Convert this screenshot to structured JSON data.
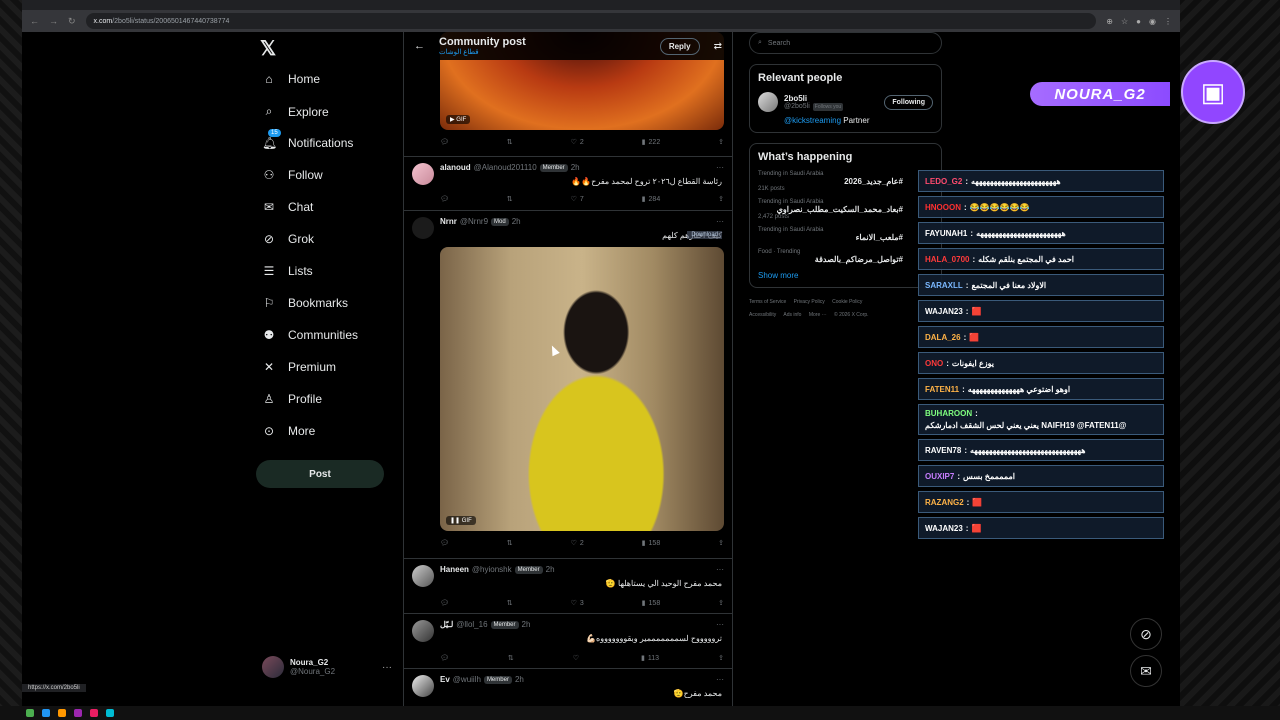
{
  "browser": {
    "url_host": "x.com",
    "url_path": "/2bo5li/status/2006501467440738774",
    "status_url": "https://x.com/2bo5li"
  },
  "nav": {
    "items": [
      {
        "label": "Home",
        "icon": "home-icon"
      },
      {
        "label": "Explore",
        "icon": "search-icon"
      },
      {
        "label": "Notifications",
        "icon": "bell-icon",
        "badge": "15"
      },
      {
        "label": "Follow",
        "icon": "add-person-icon"
      },
      {
        "label": "Chat",
        "icon": "mail-icon"
      },
      {
        "label": "Grok",
        "icon": "grok-icon"
      },
      {
        "label": "Lists",
        "icon": "list-icon"
      },
      {
        "label": "Bookmarks",
        "icon": "bookmark-icon"
      },
      {
        "label": "Communities",
        "icon": "people-icon"
      },
      {
        "label": "Premium",
        "icon": "x-icon"
      },
      {
        "label": "Profile",
        "icon": "person-icon"
      },
      {
        "label": "More",
        "icon": "more-circle-icon"
      }
    ],
    "post_label": "Post",
    "me_name": "Noura_G2",
    "me_handle": "@Noura_G2"
  },
  "timeline": {
    "title": "Community post",
    "subtitle": "قطاع الوشات",
    "reply_label": "Reply",
    "gif_label": "GIF",
    "top_actions": {
      "reply": "",
      "retweet": "",
      "like": "2",
      "views": "222"
    },
    "posts": [
      {
        "name": "alanoud",
        "handle": "@Alanoud201110",
        "role": "Member",
        "time": "2h",
        "text": "رئاسة القطاع ل٢٠٢٦ تروح لمحمد مفرح🔥🔥",
        "like": "7",
        "views": "284"
      },
      {
        "name": "Nrnr",
        "handle": "@Nrnr9",
        "role": "Mod",
        "time": "2h",
        "text": "كيف اختارهم كلهم",
        "download": "Download",
        "like": "2",
        "views": "158"
      },
      {
        "name": "Haneen",
        "handle": "@hyionshk",
        "role": "Member",
        "time": "2h",
        "text": "محمد مفرح الوحيد الي يستاهلها 🫡",
        "like": "3",
        "views": "158"
      },
      {
        "name": "لـيّل",
        "handle": "@llol_16",
        "role": "Member",
        "time": "2h",
        "text": "تروووووح لسمممممممير وبقوووووووه💪🏻",
        "like": "",
        "views": "113"
      },
      {
        "name": "Ev",
        "handle": "@wuiilh",
        "role": "Member",
        "time": "2h",
        "text": "محمد مفرح🫡"
      }
    ]
  },
  "right": {
    "search_placeholder": "Search",
    "relevant_title": "Relevant people",
    "person_name": "2bo5li",
    "person_handle": "@2bo5li",
    "follows_you": "Follows you",
    "following_label": "Following",
    "bio_link": "@kickstreaming",
    "bio_rest": " Partner",
    "happening_title": "What’s happening",
    "trends": [
      {
        "cat": "Trending in Saudi Arabia",
        "title": "#عام_جديد_2026",
        "count": "21K posts"
      },
      {
        "cat": "Trending in Saudi Arabia",
        "title": "#بعاد_محمد_السكيت_مطلب_نصراوي",
        "count": "2,472 posts"
      },
      {
        "cat": "Trending in Saudi Arabia",
        "title": "#ملعب_الانماء",
        "count": ""
      },
      {
        "cat": "Food · Trending",
        "title": "#تواصل_مرضاكم_بالصدقة",
        "count": ""
      }
    ],
    "show_more": "Show more",
    "footer": [
      "Terms of Service",
      "Privacy Policy",
      "Cookie Policy",
      "Accessibility",
      "Ads info",
      "More ···",
      "© 2026 X Corp."
    ]
  },
  "overlay": {
    "streamer": "NOURA_G2",
    "chat": [
      {
        "user": "LEDO_G2",
        "msg": "هههههههههههههههههههههههه",
        "color": "#ff4b6e"
      },
      {
        "user": "HNOOON",
        "msg": "😂😂😂😂😂😂",
        "color": "#ff3030"
      },
      {
        "user": "FAYUNAH1",
        "msg": "هههههههههههههههههههههههه",
        "color": "#ffffff"
      },
      {
        "user": "HALA_0700",
        "msg": "احمد في المجتمع بنلقم شكله",
        "color": "#ff3a3a"
      },
      {
        "user": "SARAXLL",
        "msg": "الاولاد معنا في المجتمع",
        "color": "#7ab8ff"
      },
      {
        "user": "WAJAN23",
        "msg": "🟥",
        "color": "#ffffff"
      },
      {
        "user": "DALA_26",
        "msg": "🟥",
        "color": "#ffb347"
      },
      {
        "user": "ONO",
        "msg": "يوزع ايفونات",
        "color": "#ff3a3a"
      },
      {
        "user": "FATEN11",
        "msg": "اوهو اضتوعي ههههههههههههههه",
        "color": "#ffb347"
      },
      {
        "user": "BUHAROON",
        "msg": "@NAIFH19 @FATEN11 يعني يعني لحس الشقف ادمارشكم",
        "color": "#7fff7f"
      },
      {
        "user": "RAVEN78",
        "msg": "ههههههههههههههههههههههههههههههه",
        "color": "#ffffff"
      },
      {
        "user": "OUXIP7",
        "msg": "امممممخ بسس",
        "color": "#c77dff"
      },
      {
        "user": "RAZANG2",
        "msg": "🟥",
        "color": "#ffb347"
      },
      {
        "user": "WAJAN23",
        "msg": "🟥",
        "color": "#ffffff"
      }
    ]
  }
}
